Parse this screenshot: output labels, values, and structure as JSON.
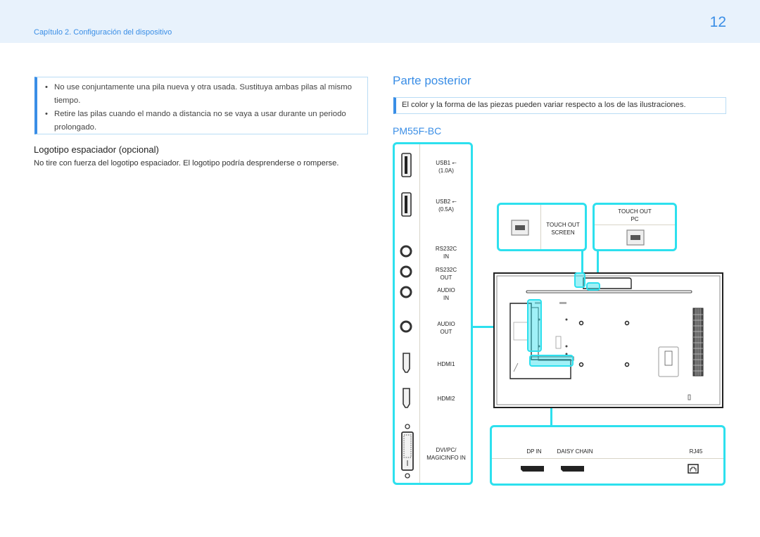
{
  "header": {
    "chapter": "Capítulo 2. Configuración del dispositivo",
    "page_number": "12"
  },
  "left": {
    "notes": [
      "No use conjuntamente una pila nueva y otra usada. Sustituya ambas pilas al mismo tiempo.",
      "Retire las pilas cuando el mando a distancia no se vaya a usar durante un periodo prolongado."
    ],
    "logo_heading": "Logotipo espaciador (opcional)",
    "logo_text": "No tire con fuerza del logotipo espaciador. El logotipo podría desprenderse o romperse."
  },
  "right": {
    "title": "Parte posterior",
    "note": "El color y la forma de las piezas pueden variar respecto a los de las ilustraciones.",
    "model": "PM55F-BC",
    "side_ports": [
      {
        "label": "USB1 ⭠\n(1.0A)",
        "icon": "usb-port-icon"
      },
      {
        "label": "USB2 ⭠\n(0.5A)",
        "icon": "usb-port-icon"
      },
      {
        "label": "RS232C\nIN",
        "icon": "round-jack-icon"
      },
      {
        "label": "RS232C\nOUT",
        "icon": "round-jack-icon"
      },
      {
        "label": "AUDIO\nIN",
        "icon": "round-jack-icon"
      },
      {
        "label": "AUDIO\nOUT",
        "icon": "round-jack-icon"
      },
      {
        "label": "HDMI1",
        "icon": "hdmi-port-icon"
      },
      {
        "label": "HDMI2",
        "icon": "hdmi-port-icon"
      },
      {
        "label": "DVI/PC/\nMAGICINFO IN",
        "icon": "dvi-port-icon"
      }
    ],
    "touch_screen_label": "TOUCH OUT\nSCREEN",
    "touch_pc_label": "TOUCH OUT\nPC",
    "bottom_ports": [
      {
        "label": "DP IN",
        "icon": "displayport-icon"
      },
      {
        "label": "DAISY CHAIN",
        "icon": "displayport-icon"
      },
      {
        "label": "RJ45",
        "icon": "rj45-port-icon"
      }
    ]
  }
}
